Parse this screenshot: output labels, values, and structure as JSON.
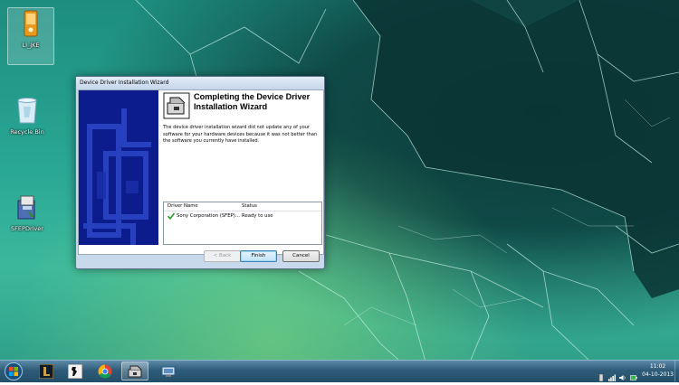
{
  "desktop": {
    "icons": [
      {
        "label": "LI_JKE",
        "icon": "phone-app-icon"
      },
      {
        "label": "Recycle Bin",
        "icon": "recycle-bin-icon"
      },
      {
        "label": "SFEPDriver",
        "icon": "installer-icon"
      }
    ]
  },
  "wizard": {
    "title": "Device Driver Installation Wizard",
    "heading": "Completing the Device Driver Installation Wizard",
    "description": "The device driver installation wizard did not update any of your software for your hardware devices because it was not better than the software you currently have installed.",
    "table": {
      "headers": [
        "Driver Name",
        "Status"
      ],
      "rows": [
        {
          "name": "Sony Corporation (SFEP)...",
          "status": "Ready to use",
          "icon": "green-check-icon"
        }
      ]
    },
    "buttons": {
      "back": "< Back",
      "finish": "Finish",
      "cancel": "Cancel"
    }
  },
  "taskbar": {
    "items": [
      "league-of-legends-icon",
      "counter-strike-icon",
      "chrome-icon",
      "device-wizard-icon",
      "network-printer-icon"
    ],
    "active_item": "device-wizard-icon",
    "clock": {
      "time": "11:02",
      "date": "04-10-2013"
    }
  }
}
